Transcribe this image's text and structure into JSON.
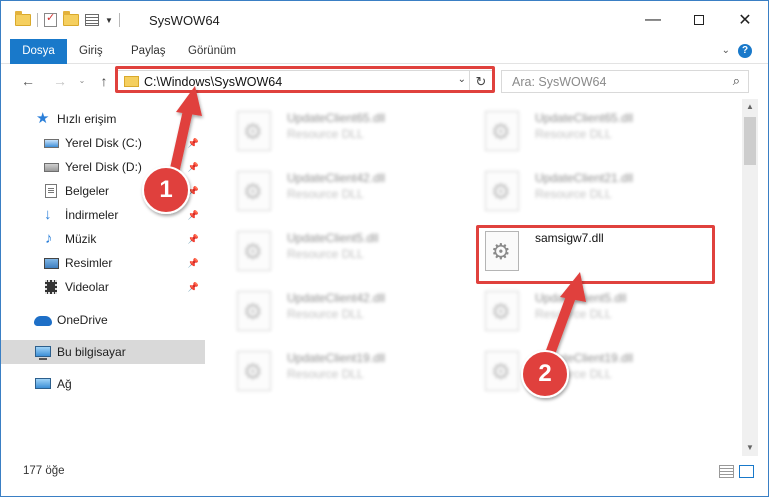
{
  "window": {
    "title": "SysWOW64",
    "controls": {
      "minimize": "—",
      "maximize": "",
      "close": "✕"
    }
  },
  "ribbon": {
    "tabs": [
      "Dosya",
      "Giriş",
      "Paylaş",
      "Görünüm"
    ],
    "expand_chevron": "⌄",
    "help": "?"
  },
  "navigation": {
    "back": "←",
    "forward": "→",
    "recent": "⌄",
    "up": "↑",
    "address": "C:\\Windows\\SysWOW64",
    "address_dropdown": "⌄",
    "refresh": "↻",
    "search_placeholder": "Ara: SysWOW64",
    "search_icon": "⌕"
  },
  "sidebar": {
    "items": [
      {
        "label": "Hızlı erişim",
        "icon": "star-icon"
      },
      {
        "label": "Yerel Disk (C:)",
        "icon": "drive-icon",
        "pinned": true
      },
      {
        "label": "Yerel Disk (D:)",
        "icon": "drive-icon",
        "pinned": true
      },
      {
        "label": "Belgeler",
        "icon": "document-icon",
        "pinned": true
      },
      {
        "label": "İndirmeler",
        "icon": "download-icon",
        "pinned": true
      },
      {
        "label": "Müzik",
        "icon": "music-icon",
        "pinned": true
      },
      {
        "label": "Resimler",
        "icon": "pictures-icon",
        "pinned": true
      },
      {
        "label": "Videolar",
        "icon": "videos-icon",
        "pinned": true
      },
      {
        "label": "OneDrive",
        "icon": "onedrive-icon"
      },
      {
        "label": "Bu bilgisayar",
        "icon": "computer-icon",
        "selected": true
      },
      {
        "label": "Ağ",
        "icon": "network-icon"
      }
    ],
    "pin_glyph": "📌"
  },
  "files": [
    {
      "name": "UpdateClient65.dll",
      "type": "Resource DLL"
    },
    {
      "name": "UpdateClient65.dll",
      "type": "Resource DLL"
    },
    {
      "name": "UpdateClient42.dll",
      "type": "Resource DLL"
    },
    {
      "name": "UpdateClient21.dll",
      "type": "Resource DLL"
    },
    {
      "name": "UpdateClient5.dll",
      "type": "Resource DLL"
    },
    {
      "name": "samsigw7.dll",
      "type": ""
    },
    {
      "name": "UpdateClient42.dll",
      "type": "Resource DLL"
    },
    {
      "name": "UpdateClient5.dll",
      "type": "Resource DLL"
    },
    {
      "name": "UpdateClient19.dll",
      "type": "Resource DLL"
    },
    {
      "name": "UpdateClient19.dll",
      "type": "Resource DLL"
    }
  ],
  "status": {
    "item_count": "177 öğe"
  },
  "scrollbar": {
    "up": "▲",
    "down": "▼"
  },
  "annotations": {
    "step1": "1",
    "step2": "2",
    "color": "#e0413d"
  }
}
